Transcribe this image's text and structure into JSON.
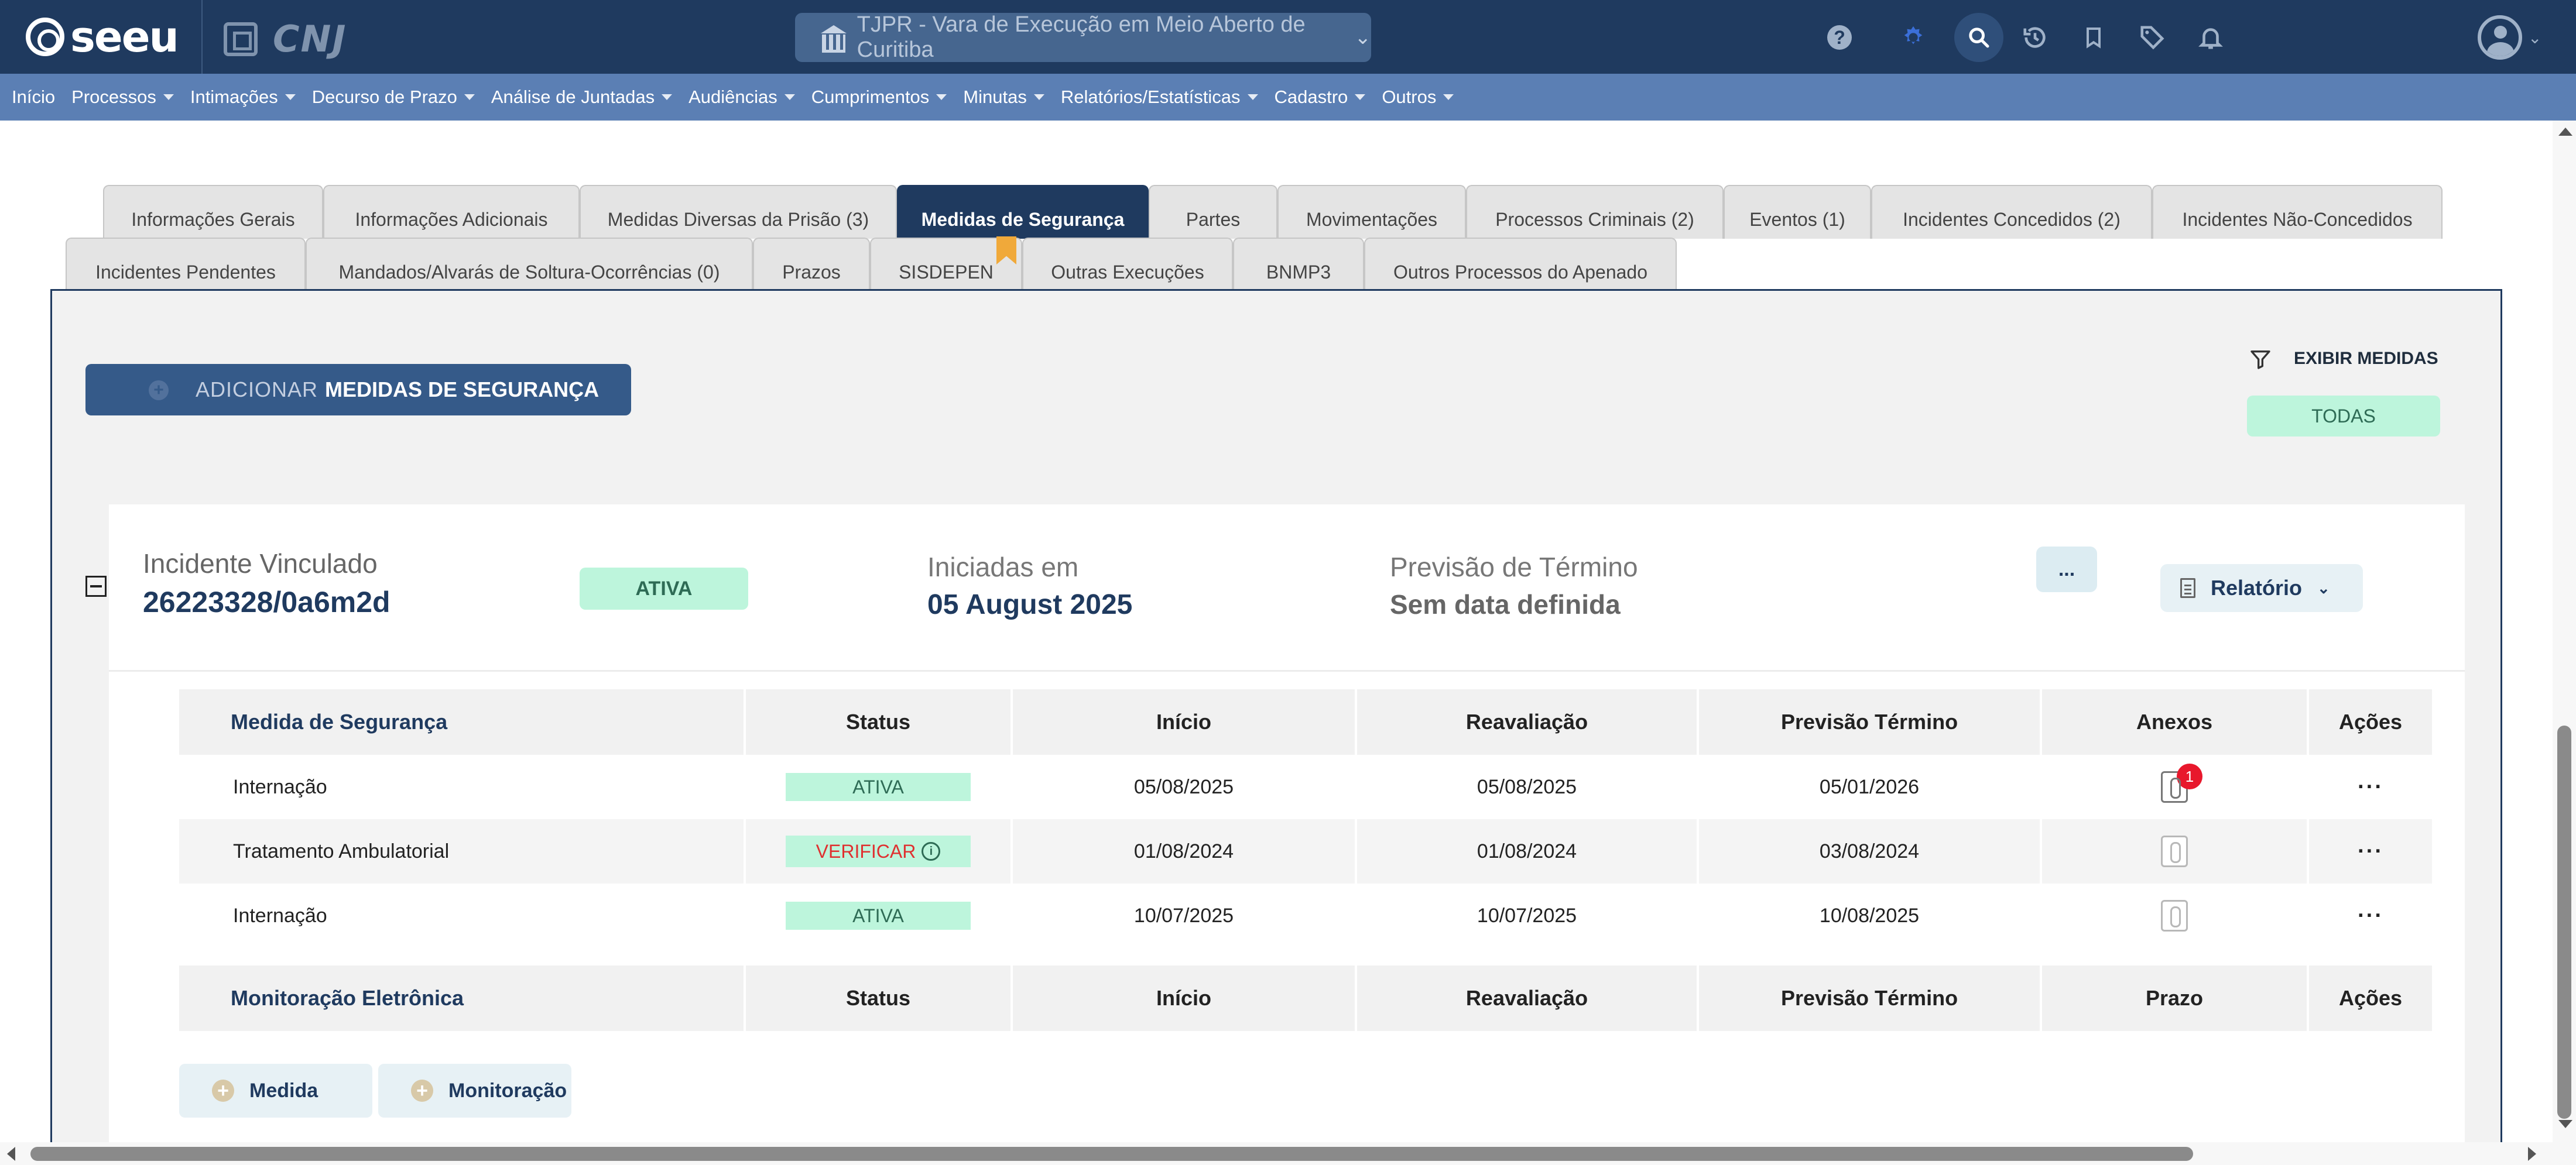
{
  "header": {
    "logo_text": "seeu",
    "cnj_text": "CNJ",
    "court_selector": "TJPR - Vara de Execução em Meio Aberto de Curitiba",
    "icons": [
      "help-icon",
      "theme-icon",
      "search-icon",
      "history-icon",
      "bookmark-icon",
      "tag-icon",
      "bell-icon",
      "user-icon"
    ]
  },
  "menu": [
    {
      "label": "Início",
      "caret": false
    },
    {
      "label": "Processos",
      "caret": true
    },
    {
      "label": "Intimações",
      "caret": true
    },
    {
      "label": "Decurso de Prazo",
      "caret": true
    },
    {
      "label": "Análise de Juntadas",
      "caret": true
    },
    {
      "label": "Audiências",
      "caret": true
    },
    {
      "label": "Cumprimentos",
      "caret": true
    },
    {
      "label": "Minutas",
      "caret": true
    },
    {
      "label": "Relatórios/Estatísticas",
      "caret": true
    },
    {
      "label": "Cadastro",
      "caret": true
    },
    {
      "label": "Outros",
      "caret": true
    }
  ],
  "tabs_row1": [
    "Informações Gerais",
    "Informações Adicionais",
    "Medidas Diversas da Prisão (3)",
    "Medidas de Segurança",
    "Partes",
    "Movimentações",
    "Processos Criminais (2)",
    "Eventos (1)",
    "Incidentes Concedidos (2)",
    "Incidentes Não-Concedidos"
  ],
  "tabs_row2": [
    "Incidentes Pendentes",
    "Mandados/Alvarás de Soltura-Ocorrências (0)",
    "Prazos",
    "SISDEPEN",
    "Outras Execuções",
    "BNMP3",
    "Outros Processos do Apenado"
  ],
  "active_tab": "Medidas de Segurança",
  "toolbar": {
    "add_prefix": "ADICIONAR",
    "add_strong": "MEDIDAS DE SEGURANÇA",
    "filter_label": "EXIBIR MEDIDAS",
    "filter_value": "TODAS"
  },
  "incident": {
    "label": "Incidente Vinculado",
    "number": "26223328/0a6m2d",
    "status": "ATIVA",
    "start_label": "Iniciadas em",
    "start_value": "05 August 2025",
    "end_label": "Previsão de Término",
    "end_value": "Sem data definida",
    "more_label": "...",
    "report_label": "Relatório"
  },
  "measures_table": {
    "headers": [
      "Medida de Segurança",
      "Status",
      "Início",
      "Reavaliação",
      "Previsão Término",
      "Anexos",
      "Ações"
    ],
    "rows": [
      {
        "medida": "Internação",
        "status": "ATIVA",
        "inicio": "05/08/2025",
        "reavaliacao": "05/08/2025",
        "previsao": "05/01/2026",
        "anexos_badge": "1",
        "acoes": "···"
      },
      {
        "medida": "Tratamento Ambulatorial",
        "status": "VERIFICAR",
        "inicio": "01/08/2024",
        "reavaliacao": "01/08/2024",
        "previsao": "03/08/2024",
        "anexos_badge": "",
        "acoes": "···"
      },
      {
        "medida": "Internação",
        "status": "ATIVA",
        "inicio": "10/07/2025",
        "reavaliacao": "10/07/2025",
        "previsao": "10/08/2025",
        "anexos_badge": "",
        "acoes": "···"
      }
    ]
  },
  "monitoring_table": {
    "headers": [
      "Monitoração Eletrônica",
      "Status",
      "Início",
      "Reavaliação",
      "Previsão Término",
      "Prazo",
      "Ações"
    ]
  },
  "bottom_buttons": {
    "medida": "Medida",
    "monitoracao": "Monitoração"
  },
  "colors": {
    "header_bg": "#1f3a5f",
    "menu_bg": "#5b7fb4",
    "active_tab_bg": "#1f3a5f",
    "status_green_bg": "#bdf5dc",
    "verificar_text": "#e03030",
    "badge_red": "#e8182c"
  }
}
